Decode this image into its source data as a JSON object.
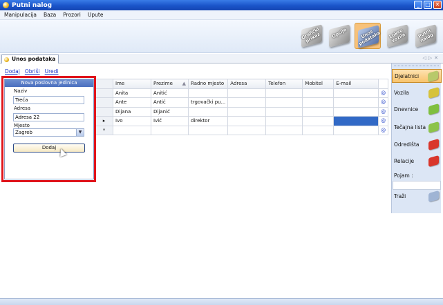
{
  "window": {
    "title": "Putni nalog"
  },
  "menu": [
    "Manipulacija",
    "Baza",
    "Prozori",
    "Upute"
  ],
  "ribbon": [
    {
      "label": "Grafički prikaz",
      "active": false
    },
    {
      "label": "Opcije",
      "active": false
    },
    {
      "label": "Unos podataka",
      "active": true
    },
    {
      "label": "Lokco vozila",
      "active": false
    },
    {
      "label": "Putni nalog",
      "active": false
    }
  ],
  "doc_tab": {
    "label": "Unos podataka"
  },
  "toolbar_links": [
    "Dodaj",
    "Obriši",
    "Uredi"
  ],
  "grid": {
    "columns": [
      "Ime",
      "Prezime",
      "Radno mjesto",
      "Adresa",
      "Telefon",
      "Mobitel",
      "E-mail"
    ],
    "rows": [
      [
        "Anita",
        "Anitić",
        "",
        "",
        "",
        "",
        ""
      ],
      [
        "Ante",
        "Antić",
        "trgovački pu...",
        "",
        "",
        "",
        ""
      ],
      [
        "Dijana",
        "Dijanić",
        "",
        "",
        "",
        "",
        ""
      ],
      [
        "Ivo",
        "Ivić",
        "direktor",
        "",
        "",
        "",
        ""
      ]
    ],
    "new_row_marker": "*",
    "current_row_marker": "▸",
    "email_icon": "@"
  },
  "form": {
    "title": "Nova poslovna jedinica",
    "naziv_label": "Naziv",
    "naziv_value": "Treća",
    "adresa_label": "Adresa",
    "adresa_value": "Adresa 22",
    "mjesto_label": "Mjesto",
    "mjesto_value": "Zagreb",
    "submit_label": "Dodaj"
  },
  "right_panel": {
    "items": [
      {
        "label": "Djelatnici",
        "icon": "people-icon",
        "color": "#b8c96a",
        "active": true
      },
      {
        "label": "Vozila",
        "icon": "car-icon",
        "color": "#d6c23b",
        "active": false
      },
      {
        "label": "Dnevnice",
        "icon": "money-icon",
        "color": "#7fbf3f",
        "active": false
      },
      {
        "label": "Tečajna lista",
        "icon": "exchange-icon",
        "color": "#8cc34a",
        "active": false
      },
      {
        "label": "Odredišta",
        "icon": "destination-icon",
        "color": "#d9362b",
        "active": false
      },
      {
        "label": "Relacije",
        "icon": "route-icon",
        "color": "#d9362b",
        "active": false
      }
    ],
    "search_label": "Pojam :",
    "search_button": "Traži"
  }
}
